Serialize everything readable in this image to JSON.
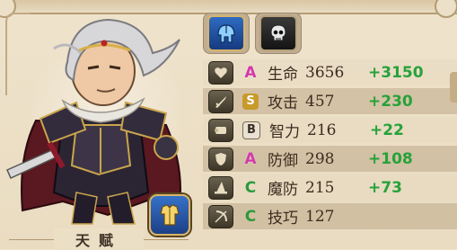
{
  "header": {
    "tabs": [
      {
        "icon": "helmet-icon"
      },
      {
        "icon": "skull-icon"
      }
    ]
  },
  "talent": {
    "label": "天赋"
  },
  "equip": {
    "icon": "armor-icon"
  },
  "stats": [
    {
      "name": "生命",
      "value": "3656",
      "bonus": "+3150",
      "grade": "A",
      "icon": "heart-icon"
    },
    {
      "name": "攻击",
      "value": "457",
      "bonus": "+230",
      "grade": "S",
      "icon": "sword-icon"
    },
    {
      "name": "智力",
      "value": "216",
      "bonus": "+22",
      "grade": "B",
      "icon": "scroll-icon"
    },
    {
      "name": "防御",
      "value": "298",
      "bonus": "+108",
      "grade": "A",
      "icon": "shield-icon"
    },
    {
      "name": "魔防",
      "value": "215",
      "bonus": "+73",
      "grade": "C",
      "icon": "wizard-hat-icon"
    },
    {
      "name": "技巧",
      "value": "127",
      "bonus": "",
      "grade": "C",
      "icon": "bow-icon"
    }
  ],
  "colors": {
    "bonus": "#27a23a",
    "grade_A": "#d23aa8",
    "grade_C": "#2c9a3b"
  }
}
